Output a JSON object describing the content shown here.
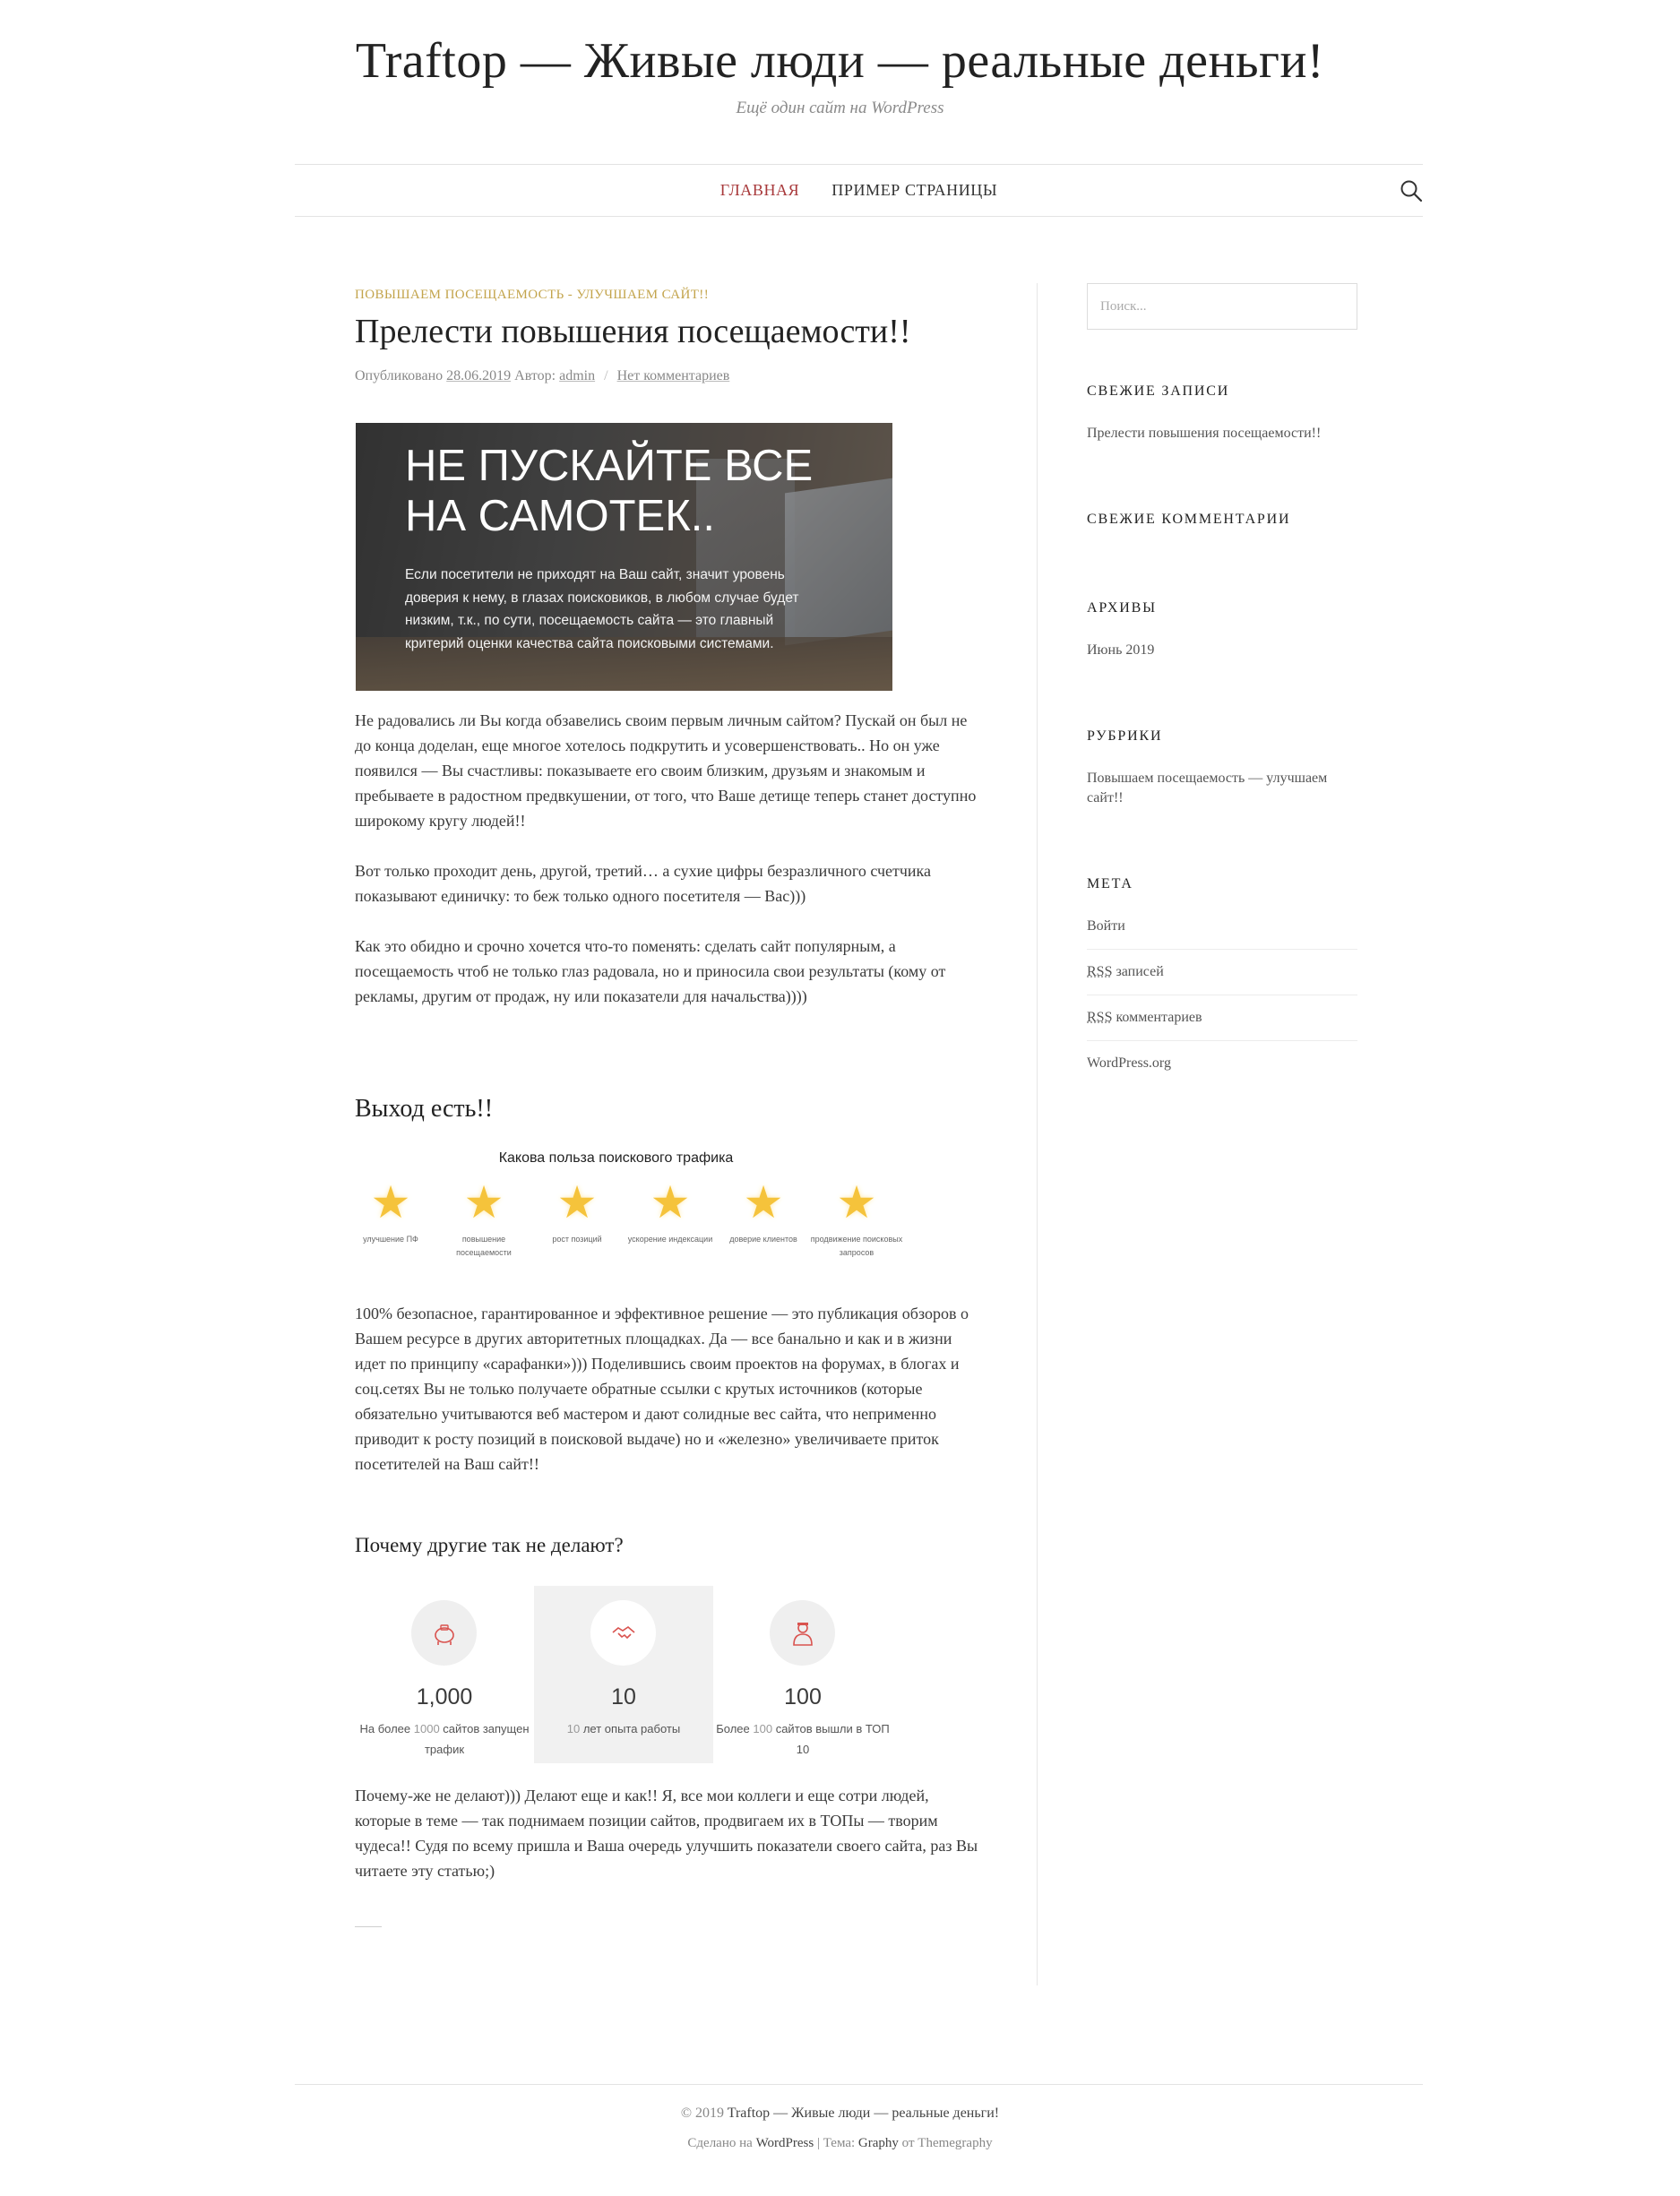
{
  "header": {
    "site_title": "Traftop — Живые люди — реальные деньги!",
    "site_description": "Ещё один сайт на WordPress"
  },
  "nav": {
    "items": [
      {
        "label": "ГЛАВНАЯ",
        "active": true
      },
      {
        "label": "ПРИМЕР СТРАНИЦЫ",
        "active": false
      }
    ],
    "search_icon": "search-icon"
  },
  "post": {
    "category": "ПОВЫШАЕМ ПОСЕЩАЕМОСТЬ - УЛУЧШАЕМ САЙТ!!",
    "title": "Прелести повышения посещаемости!!",
    "meta": {
      "published_label": "Опубликовано",
      "date": "28.06.2019",
      "author_label": "Автор:",
      "author": "admin",
      "separator": "/",
      "comments": "Нет комментариев"
    },
    "banner": {
      "heading": "НЕ ПУСКАЙТЕ ВСЕ НА САМОТЕК..",
      "body": "Если посетители не приходят на Ваш сайт, значит уровень доверия к нему, в глазах поисковиков, в любом случае будет низким, т.к., по сути, посещаемость сайта — это главный критерий оценки качества сайта поисковыми системами."
    },
    "paragraphs": [
      "Не радовались ли Вы когда обзавелись своим первым личным сайтом? Пускай он был не до конца доделан, еще многое хотелось подкрутить и усовершенствовать.. Но он уже появился — Вы счастливы: показываете его своим близким, друзьям и знакомым и пребываете в радостном предвкушении, от того, что Ваше детище теперь станет доступно широкому кругу людей!!",
      "Вот только проходит день, другой, третий… а сухие цифры безразличного счетчика показывают единичку: то беж только одного посетителя — Вас)))",
      "Как это обидно и срочно хочется что-то поменять: сделать сайт популярным, а посещаемость чтоб не только глаз радовала, но и приносила свои результаты (кому от рекламы, другим от продаж, ну или показатели для начальства))))"
    ],
    "heading_exit": "Выход есть!!",
    "benefits": {
      "title": "Какова польза поискового трафика",
      "items": [
        {
          "icon": "star-icon",
          "label": "улучшение ПФ"
        },
        {
          "icon": "star-icon",
          "label": "повышение посещаемости"
        },
        {
          "icon": "star-icon",
          "label": "рост позиций"
        },
        {
          "icon": "star-icon",
          "label": "ускорение индексации"
        },
        {
          "icon": "star-icon",
          "label": "доверие клиентов"
        },
        {
          "icon": "star-icon",
          "label": "продвижение поисковых запросов"
        }
      ]
    },
    "paragraph_solution": "100% безопасное, гарантированное и эффективное решение — это публикация обзоров о Вашем ресурсе в других авторитетных площадках. Да — все банально и как и в жизни идет по принципу «сарафанки»))) Поделившись своим проектов на форумах, в блогах и соц.сетях Вы не только получаете обратные ссылки с крутых источников (которые обязательно учитываются веб мастером и дают солидные вес сайта, что неприменно приводит к росту позиций в поисковой выдаче) но и «железно» увеличиваете приток посетителей на Ваш сайт!!",
    "heading_why": "Почему другие так не делают?",
    "stats": [
      {
        "icon": "piggy-bank-icon",
        "number": "1,000",
        "caption_pre": "На более ",
        "caption_hl": "1000",
        "caption_post": " сайтов запущен трафик"
      },
      {
        "icon": "handshake-icon",
        "number": "10",
        "caption_pre": "",
        "caption_hl": "10",
        "caption_post": " лет опыта работы"
      },
      {
        "icon": "person-icon",
        "number": "100",
        "caption_pre": "Более ",
        "caption_hl": "100",
        "caption_post": " сайтов вышли в ТОП 10"
      }
    ],
    "paragraph_final": "Почему-же не делают))) Делают еще и как!! Я, все мои коллеги и еще сотри людей, которые в теме — так поднимаем позиции сайтов, продвигаем их в ТОПы — творим чудеса!! Судя по всему пришла и Ваша очередь улучшить показатели своего сайта, раз Вы читаете эту статью;)"
  },
  "sidebar": {
    "search_placeholder": "Поиск...",
    "recent_posts": {
      "title": "СВЕЖИЕ ЗАПИСИ",
      "items": [
        "Прелести повышения посещаемости!!"
      ]
    },
    "recent_comments": {
      "title": "СВЕЖИЕ КОММЕНТАРИИ"
    },
    "archives": {
      "title": "АРХИВЫ",
      "items": [
        "Июнь 2019"
      ]
    },
    "categories": {
      "title": "РУБРИКИ",
      "items": [
        "Повышаем посещаемость — улучшаем сайт!!"
      ]
    },
    "meta": {
      "title": "МЕТА",
      "items": [
        {
          "pre": "",
          "abbr": "",
          "post": "Войти"
        },
        {
          "pre": "",
          "abbr": "RSS",
          "post": " записей"
        },
        {
          "pre": "",
          "abbr": "RSS",
          "post": " комментариев"
        },
        {
          "pre": "",
          "abbr": "",
          "post": "WordPress.org"
        }
      ]
    }
  },
  "footer": {
    "copyright_prefix": "© 2019",
    "copyright_site": "Traftop — Живые люди — реальные деньги!",
    "made_on": "Сделано на",
    "wordpress": "WordPress",
    "pipe": "|",
    "theme_label": "Тема:",
    "theme": "Graphy",
    "by": "от",
    "author": "Themegraphy"
  },
  "colors": {
    "accent_red": "#a8393b",
    "category_gold": "#c3a44c",
    "star_yellow": "#f5c33b"
  }
}
